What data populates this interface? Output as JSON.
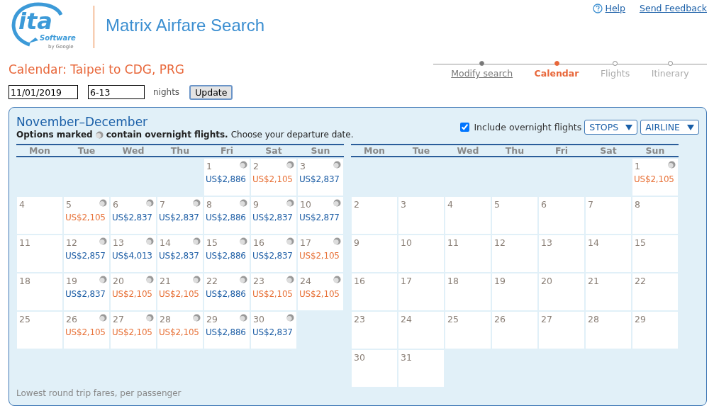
{
  "logo": {
    "word": "ita",
    "sub": "Software",
    "byline": "by Google"
  },
  "app_title": "Matrix Airfare Search",
  "top_links": [
    {
      "label": "Help",
      "kind": "help"
    },
    {
      "label": "Send Feedback",
      "kind": "plain"
    }
  ],
  "steps": [
    {
      "label": "Modify search",
      "kind": "done",
      "selected": false
    },
    {
      "label": "Calendar",
      "kind": "current",
      "selected": true
    },
    {
      "label": "Flights",
      "kind": "upcoming",
      "selected": false
    },
    {
      "label": "Itinerary",
      "kind": "upcoming",
      "selected": false
    }
  ],
  "page_title": "Calendar: Taipei to CDG, PRG",
  "form": {
    "date": "11/01/2019",
    "nights": "6-13",
    "nights_label": "nights",
    "button": "Update"
  },
  "panel": {
    "title": "November–December",
    "note_bold_1": "Options marked",
    "note_bold_2": "contain overnight flights.",
    "note_rest": "Choose your departure date.",
    "overnight_checkbox": {
      "label": "Include overnight flights",
      "checked": true
    },
    "dropdowns": [
      "STOPS",
      "AIRLINE"
    ],
    "footer": "Lowest round trip fares, per passenger"
  },
  "months": [
    {
      "weekdays": [
        "Mon",
        "Tue",
        "Wed",
        "Thu",
        "Fri",
        "Sat",
        "Sun"
      ],
      "weeks": [
        [
          {
            "kind": "empty"
          },
          {
            "kind": "empty"
          },
          {
            "kind": "empty"
          },
          {
            "kind": "empty"
          },
          {
            "kind": "day",
            "day": "1",
            "fare": "US$2,886",
            "lowest": false,
            "overnight": true
          },
          {
            "kind": "day",
            "day": "2",
            "fare": "US$2,105",
            "lowest": true,
            "overnight": true
          },
          {
            "kind": "day",
            "day": "3",
            "fare": "US$2,837",
            "lowest": false,
            "overnight": true
          }
        ],
        [
          {
            "kind": "day",
            "day": "4"
          },
          {
            "kind": "day",
            "day": "5",
            "fare": "US$2,105",
            "lowest": true,
            "overnight": true
          },
          {
            "kind": "day",
            "day": "6",
            "fare": "US$2,837",
            "lowest": false,
            "overnight": true
          },
          {
            "kind": "day",
            "day": "7",
            "fare": "US$2,837",
            "lowest": false,
            "overnight": true
          },
          {
            "kind": "day",
            "day": "8",
            "fare": "US$2,886",
            "lowest": false,
            "overnight": true
          },
          {
            "kind": "day",
            "day": "9",
            "fare": "US$2,837",
            "lowest": false,
            "overnight": true
          },
          {
            "kind": "day",
            "day": "10",
            "fare": "US$2,877",
            "lowest": false,
            "overnight": true
          }
        ],
        [
          {
            "kind": "day",
            "day": "11"
          },
          {
            "kind": "day",
            "day": "12",
            "fare": "US$2,857",
            "lowest": false,
            "overnight": true
          },
          {
            "kind": "day",
            "day": "13",
            "fare": "US$4,013",
            "lowest": false,
            "overnight": true
          },
          {
            "kind": "day",
            "day": "14",
            "fare": "US$2,837",
            "lowest": false,
            "overnight": true
          },
          {
            "kind": "day",
            "day": "15",
            "fare": "US$2,886",
            "lowest": false,
            "overnight": true
          },
          {
            "kind": "day",
            "day": "16",
            "fare": "US$2,837",
            "lowest": false,
            "overnight": true
          },
          {
            "kind": "day",
            "day": "17",
            "fare": "US$2,105",
            "lowest": true,
            "overnight": true
          }
        ],
        [
          {
            "kind": "day",
            "day": "18"
          },
          {
            "kind": "day",
            "day": "19",
            "fare": "US$2,837",
            "lowest": false,
            "overnight": true
          },
          {
            "kind": "day",
            "day": "20",
            "fare": "US$2,105",
            "lowest": true,
            "overnight": true
          },
          {
            "kind": "day",
            "day": "21",
            "fare": "US$2,105",
            "lowest": true,
            "overnight": true
          },
          {
            "kind": "day",
            "day": "22",
            "fare": "US$2,886",
            "lowest": false,
            "overnight": true
          },
          {
            "kind": "day",
            "day": "23",
            "fare": "US$2,105",
            "lowest": true,
            "overnight": true
          },
          {
            "kind": "day",
            "day": "24",
            "fare": "US$2,105",
            "lowest": true,
            "overnight": true
          }
        ],
        [
          {
            "kind": "day",
            "day": "25"
          },
          {
            "kind": "day",
            "day": "26",
            "fare": "US$2,105",
            "lowest": true,
            "overnight": true
          },
          {
            "kind": "day",
            "day": "27",
            "fare": "US$2,105",
            "lowest": true,
            "overnight": true
          },
          {
            "kind": "day",
            "day": "28",
            "fare": "US$2,105",
            "lowest": true,
            "overnight": true
          },
          {
            "kind": "day",
            "day": "29",
            "fare": "US$2,886",
            "lowest": false,
            "overnight": true
          },
          {
            "kind": "day",
            "day": "30",
            "fare": "US$2,837",
            "lowest": false,
            "overnight": true
          },
          {
            "kind": "empty"
          }
        ]
      ]
    },
    {
      "weekdays": [
        "Mon",
        "Tue",
        "Wed",
        "Thu",
        "Fri",
        "Sat",
        "Sun"
      ],
      "weeks": [
        [
          {
            "kind": "empty"
          },
          {
            "kind": "empty"
          },
          {
            "kind": "empty"
          },
          {
            "kind": "empty"
          },
          {
            "kind": "empty"
          },
          {
            "kind": "empty"
          },
          {
            "kind": "day",
            "day": "1",
            "fare": "US$2,105",
            "lowest": true,
            "overnight": true
          }
        ],
        [
          {
            "kind": "day",
            "day": "2"
          },
          {
            "kind": "day",
            "day": "3"
          },
          {
            "kind": "day",
            "day": "4"
          },
          {
            "kind": "day",
            "day": "5"
          },
          {
            "kind": "day",
            "day": "6"
          },
          {
            "kind": "day",
            "day": "7"
          },
          {
            "kind": "day",
            "day": "8"
          }
        ],
        [
          {
            "kind": "day",
            "day": "9"
          },
          {
            "kind": "day",
            "day": "10"
          },
          {
            "kind": "day",
            "day": "11"
          },
          {
            "kind": "day",
            "day": "12"
          },
          {
            "kind": "day",
            "day": "13"
          },
          {
            "kind": "day",
            "day": "14"
          },
          {
            "kind": "day",
            "day": "15"
          }
        ],
        [
          {
            "kind": "day",
            "day": "16"
          },
          {
            "kind": "day",
            "day": "17"
          },
          {
            "kind": "day",
            "day": "18"
          },
          {
            "kind": "day",
            "day": "19"
          },
          {
            "kind": "day",
            "day": "20"
          },
          {
            "kind": "day",
            "day": "21"
          },
          {
            "kind": "day",
            "day": "22"
          }
        ],
        [
          {
            "kind": "day",
            "day": "23"
          },
          {
            "kind": "day",
            "day": "24"
          },
          {
            "kind": "day",
            "day": "25"
          },
          {
            "kind": "day",
            "day": "26"
          },
          {
            "kind": "day",
            "day": "27"
          },
          {
            "kind": "day",
            "day": "28"
          },
          {
            "kind": "day",
            "day": "29"
          }
        ],
        [
          {
            "kind": "day",
            "day": "30"
          },
          {
            "kind": "day",
            "day": "31"
          },
          {
            "kind": "empty"
          },
          {
            "kind": "empty"
          },
          {
            "kind": "empty"
          },
          {
            "kind": "empty"
          },
          {
            "kind": "empty"
          }
        ]
      ]
    }
  ]
}
